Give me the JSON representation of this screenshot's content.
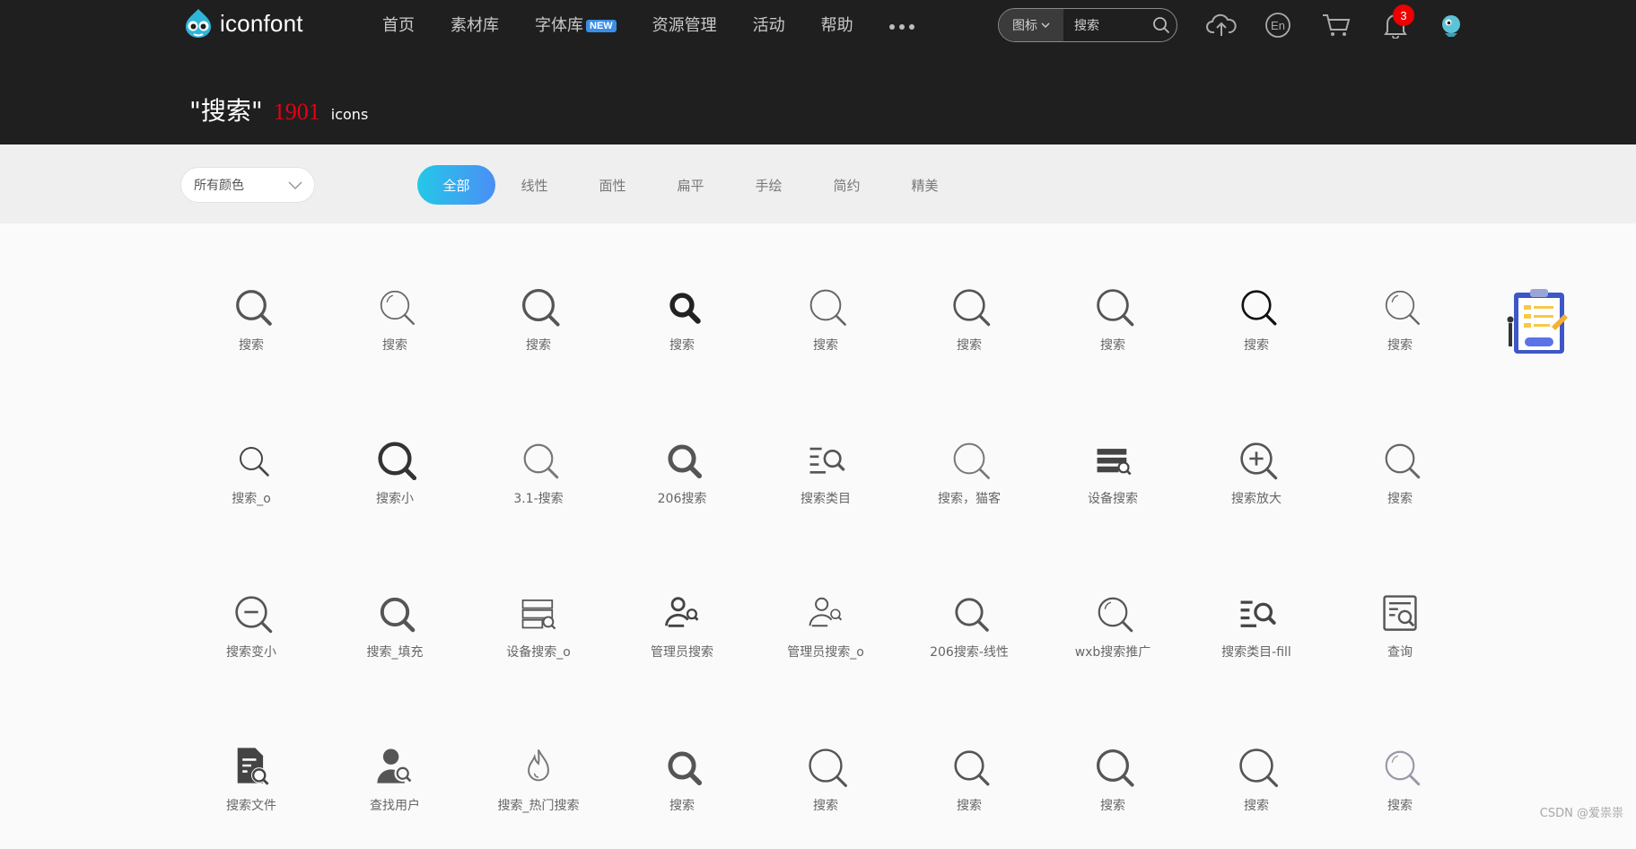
{
  "header": {
    "logo_text": "iconfont",
    "nav": [
      {
        "label": "首页"
      },
      {
        "label": "素材库"
      },
      {
        "label": "字体库",
        "badge": "NEW"
      },
      {
        "label": "资源管理"
      },
      {
        "label": "活动"
      },
      {
        "label": "帮助"
      }
    ],
    "search": {
      "type_label": "图标",
      "value": "搜索",
      "placeholder": "搜索"
    },
    "tools": {
      "upload_icon": "cloud-upload-icon",
      "language_icon": "language-en-icon",
      "cart_icon": "cart-icon",
      "bell_icon": "bell-icon",
      "notification_count": "3"
    }
  },
  "result": {
    "query": "\"搜索\"",
    "count": "1901",
    "unit": "icons"
  },
  "filters": {
    "color_label": "所有颜色",
    "styles": [
      {
        "label": "全部",
        "active": true
      },
      {
        "label": "线性"
      },
      {
        "label": "面性"
      },
      {
        "label": "扁平"
      },
      {
        "label": "手绘"
      },
      {
        "label": "简约"
      },
      {
        "label": "精美"
      }
    ]
  },
  "icons": [
    {
      "label": "搜索",
      "kind": "mag",
      "w": 3,
      "c": "#555",
      "r": 14
    },
    {
      "label": "搜索",
      "kind": "mag_thin",
      "w": 1.6,
      "c": "#666",
      "r": 14
    },
    {
      "label": "搜索",
      "kind": "mag",
      "w": 3,
      "c": "#555",
      "r": 15
    },
    {
      "label": "搜索",
      "kind": "mag_bold",
      "w": 5,
      "c": "#222",
      "r": 10
    },
    {
      "label": "搜索",
      "kind": "mag",
      "w": 1.8,
      "c": "#666",
      "r": 15
    },
    {
      "label": "搜索",
      "kind": "mag",
      "w": 2.4,
      "c": "#555",
      "r": 15
    },
    {
      "label": "搜索",
      "kind": "mag",
      "w": 2.6,
      "c": "#555",
      "r": 15
    },
    {
      "label": "搜索",
      "kind": "mag",
      "w": 2.4,
      "c": "#111",
      "r": 14
    },
    {
      "label": "搜索",
      "kind": "mag_thin",
      "w": 1.6,
      "c": "#666",
      "r": 14
    },
    {
      "label": "搜索_o",
      "kind": "mag",
      "w": 1.8,
      "c": "#444",
      "r": 11
    },
    {
      "label": "搜索小",
      "kind": "mag",
      "w": 4,
      "c": "#333",
      "r": 15
    },
    {
      "label": "3.1-搜索",
      "kind": "mag",
      "w": 2,
      "c": "#777",
      "r": 14
    },
    {
      "label": "206搜索",
      "kind": "mag",
      "w": 4.5,
      "c": "#555",
      "r": 12
    },
    {
      "label": "搜索类目",
      "kind": "list_search",
      "w": 2.4,
      "c": "#555"
    },
    {
      "label": "搜索，猫客",
      "kind": "mag",
      "w": 1.8,
      "c": "#777",
      "r": 15
    },
    {
      "label": "设备搜索",
      "kind": "server_search",
      "w": 2,
      "c": "#444"
    },
    {
      "label": "搜索放大",
      "kind": "zoom_in",
      "w": 2.4,
      "c": "#555"
    },
    {
      "label": "搜索",
      "kind": "mag",
      "w": 2,
      "c": "#666",
      "r": 14
    },
    {
      "label": "搜索变小",
      "kind": "zoom_out",
      "w": 2.4,
      "c": "#555"
    },
    {
      "label": "搜索_填充",
      "kind": "mag",
      "w": 3.6,
      "c": "#555",
      "r": 13
    },
    {
      "label": "设备搜索_o",
      "kind": "server_search_o",
      "w": 1.8,
      "c": "#555"
    },
    {
      "label": "管理员搜索",
      "kind": "user_search",
      "w": 2.6,
      "c": "#444"
    },
    {
      "label": "管理员搜索_o",
      "kind": "user_search",
      "w": 1.8,
      "c": "#555"
    },
    {
      "label": "206搜索-线性",
      "kind": "mag",
      "w": 2.6,
      "c": "#555",
      "r": 13
    },
    {
      "label": "wxb搜索推广",
      "kind": "mag_thin",
      "w": 2,
      "c": "#555",
      "r": 14
    },
    {
      "label": "搜索类目-fill",
      "kind": "list_search",
      "w": 3,
      "c": "#444"
    },
    {
      "label": "查询",
      "kind": "doc_search",
      "w": 2.2,
      "c": "#555"
    },
    {
      "label": "搜索文件",
      "kind": "file_search",
      "w": 2,
      "c": "#444"
    },
    {
      "label": "查找用户",
      "kind": "person_search",
      "w": 2,
      "c": "#555"
    },
    {
      "label": "搜索_热门搜索",
      "kind": "flame",
      "w": 1.8,
      "c": "#777"
    },
    {
      "label": "搜索",
      "kind": "mag",
      "w": 4.5,
      "c": "#555",
      "r": 12
    },
    {
      "label": "搜索",
      "kind": "mag",
      "w": 2.2,
      "c": "#555",
      "r": 16
    },
    {
      "label": "搜索",
      "kind": "mag",
      "w": 2.4,
      "c": "#555",
      "r": 14
    },
    {
      "label": "搜索",
      "kind": "mag",
      "w": 3,
      "c": "#555",
      "r": 15
    },
    {
      "label": "搜索",
      "kind": "mag",
      "w": 2.4,
      "c": "#555",
      "r": 16
    },
    {
      "label": "搜索",
      "kind": "mag_thin",
      "w": 2,
      "c": "#99a",
      "r": 14
    }
  ],
  "watermark": "CSDN @爱祟祟"
}
